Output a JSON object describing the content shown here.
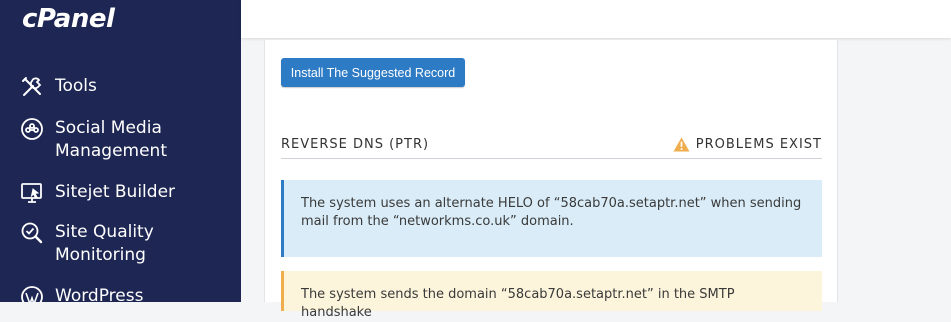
{
  "sidebar": {
    "logo": "cPanel",
    "items": [
      {
        "label": "Tools",
        "icon": "tools-icon"
      },
      {
        "label": "Social Media Management",
        "icon": "social-media-icon"
      },
      {
        "label": "Sitejet Builder",
        "icon": "sitejet-icon"
      },
      {
        "label": "Site Quality Monitoring",
        "icon": "site-quality-icon"
      },
      {
        "label": "WordPress",
        "icon": "wordpress-icon"
      }
    ]
  },
  "main": {
    "install_button": "Install The Suggested Record",
    "section": {
      "title": "REVERSE DNS (PTR)",
      "status": "PROBLEMS EXIST",
      "status_icon": "warning-icon"
    },
    "info_message": "The system uses an alternate HELO of “58cab70a.setaptr.net” when sending mail from the “networkms.co.uk” domain.",
    "warning_message": "The system sends the domain “58cab70a.setaptr.net” in the SMTP handshake"
  },
  "colors": {
    "sidebar_bg": "#1e2753",
    "primary": "#2d7ac5",
    "info_bg": "#d9ecf7",
    "warning_bg": "#fcf4db",
    "warning_accent": "#f0ad4e"
  }
}
